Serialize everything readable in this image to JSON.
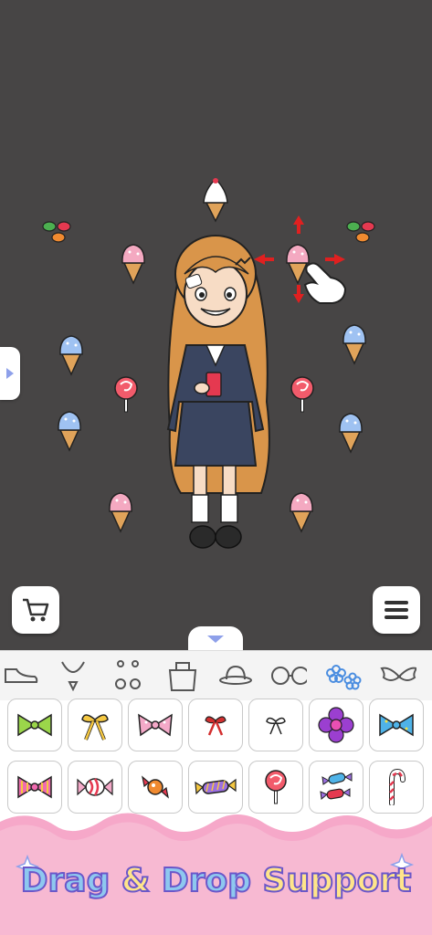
{
  "banner": {
    "word1": "Drag",
    "amp": "&",
    "word2": "Drop",
    "word3": "Support"
  },
  "toolbar": {
    "cart_icon": "cart-icon",
    "menu_icon": "hamburger-menu-icon",
    "collapse_icon": "chevron-down-icon",
    "side_handle_icon": "chevron-right-icon"
  },
  "categories": [
    {
      "icon": "shoe-icon"
    },
    {
      "icon": "necklace-icon"
    },
    {
      "icon": "earrings-icon"
    },
    {
      "icon": "bag-icon"
    },
    {
      "icon": "hat-icon"
    },
    {
      "icon": "glasses-icon"
    },
    {
      "icon": "flower-sticker-icon",
      "selected": true
    },
    {
      "icon": "wings-icon"
    }
  ],
  "items_row1": [
    "green-bow",
    "yellow-ribbon",
    "pink-bow",
    "red-ribbon",
    "black-ribbon",
    "purple-flower",
    "blue-bow"
  ],
  "items_row2": [
    "pink-striped-bow",
    "candy-wrapper",
    "wrapped-candy",
    "purple-candy",
    "lollipop",
    "candies",
    "candy-cane"
  ],
  "colors": {
    "background": "#474545",
    "accent": "#8ea0ea",
    "banner_pink": "#f6a8c9",
    "banner_text": "#8ec8ef",
    "banner_outline": "#6b57c9"
  }
}
